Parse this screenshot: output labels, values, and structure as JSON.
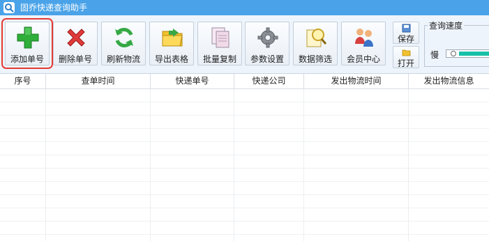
{
  "window": {
    "title": "固乔快递查询助手",
    "accent": "#4aa3e8"
  },
  "toolbar": {
    "buttons": [
      {
        "key": "add",
        "label": "添加单号",
        "icon": "plus-icon",
        "selected": true
      },
      {
        "key": "delete",
        "label": "删除单号",
        "icon": "x-icon"
      },
      {
        "key": "refresh",
        "label": "刷新物流",
        "icon": "refresh-icon"
      },
      {
        "key": "export",
        "label": "导出表格",
        "icon": "folder-icon"
      },
      {
        "key": "batch-copy",
        "label": "批量复制",
        "icon": "copy-icon"
      },
      {
        "key": "settings",
        "label": "参数设置",
        "icon": "gear-icon"
      },
      {
        "key": "filter",
        "label": "数据筛选",
        "icon": "search-document-icon"
      },
      {
        "key": "member",
        "label": "会员中心",
        "icon": "users-icon"
      }
    ],
    "save_label": "保存",
    "open_label": "打开",
    "speed": {
      "label": "查询速度",
      "slow_label": "慢",
      "level_percent": 0
    }
  },
  "table": {
    "columns": [
      "序号",
      "查单时间",
      "快递单号",
      "快递公司",
      "发出物流时间",
      "发出物流信息"
    ],
    "rows": []
  }
}
